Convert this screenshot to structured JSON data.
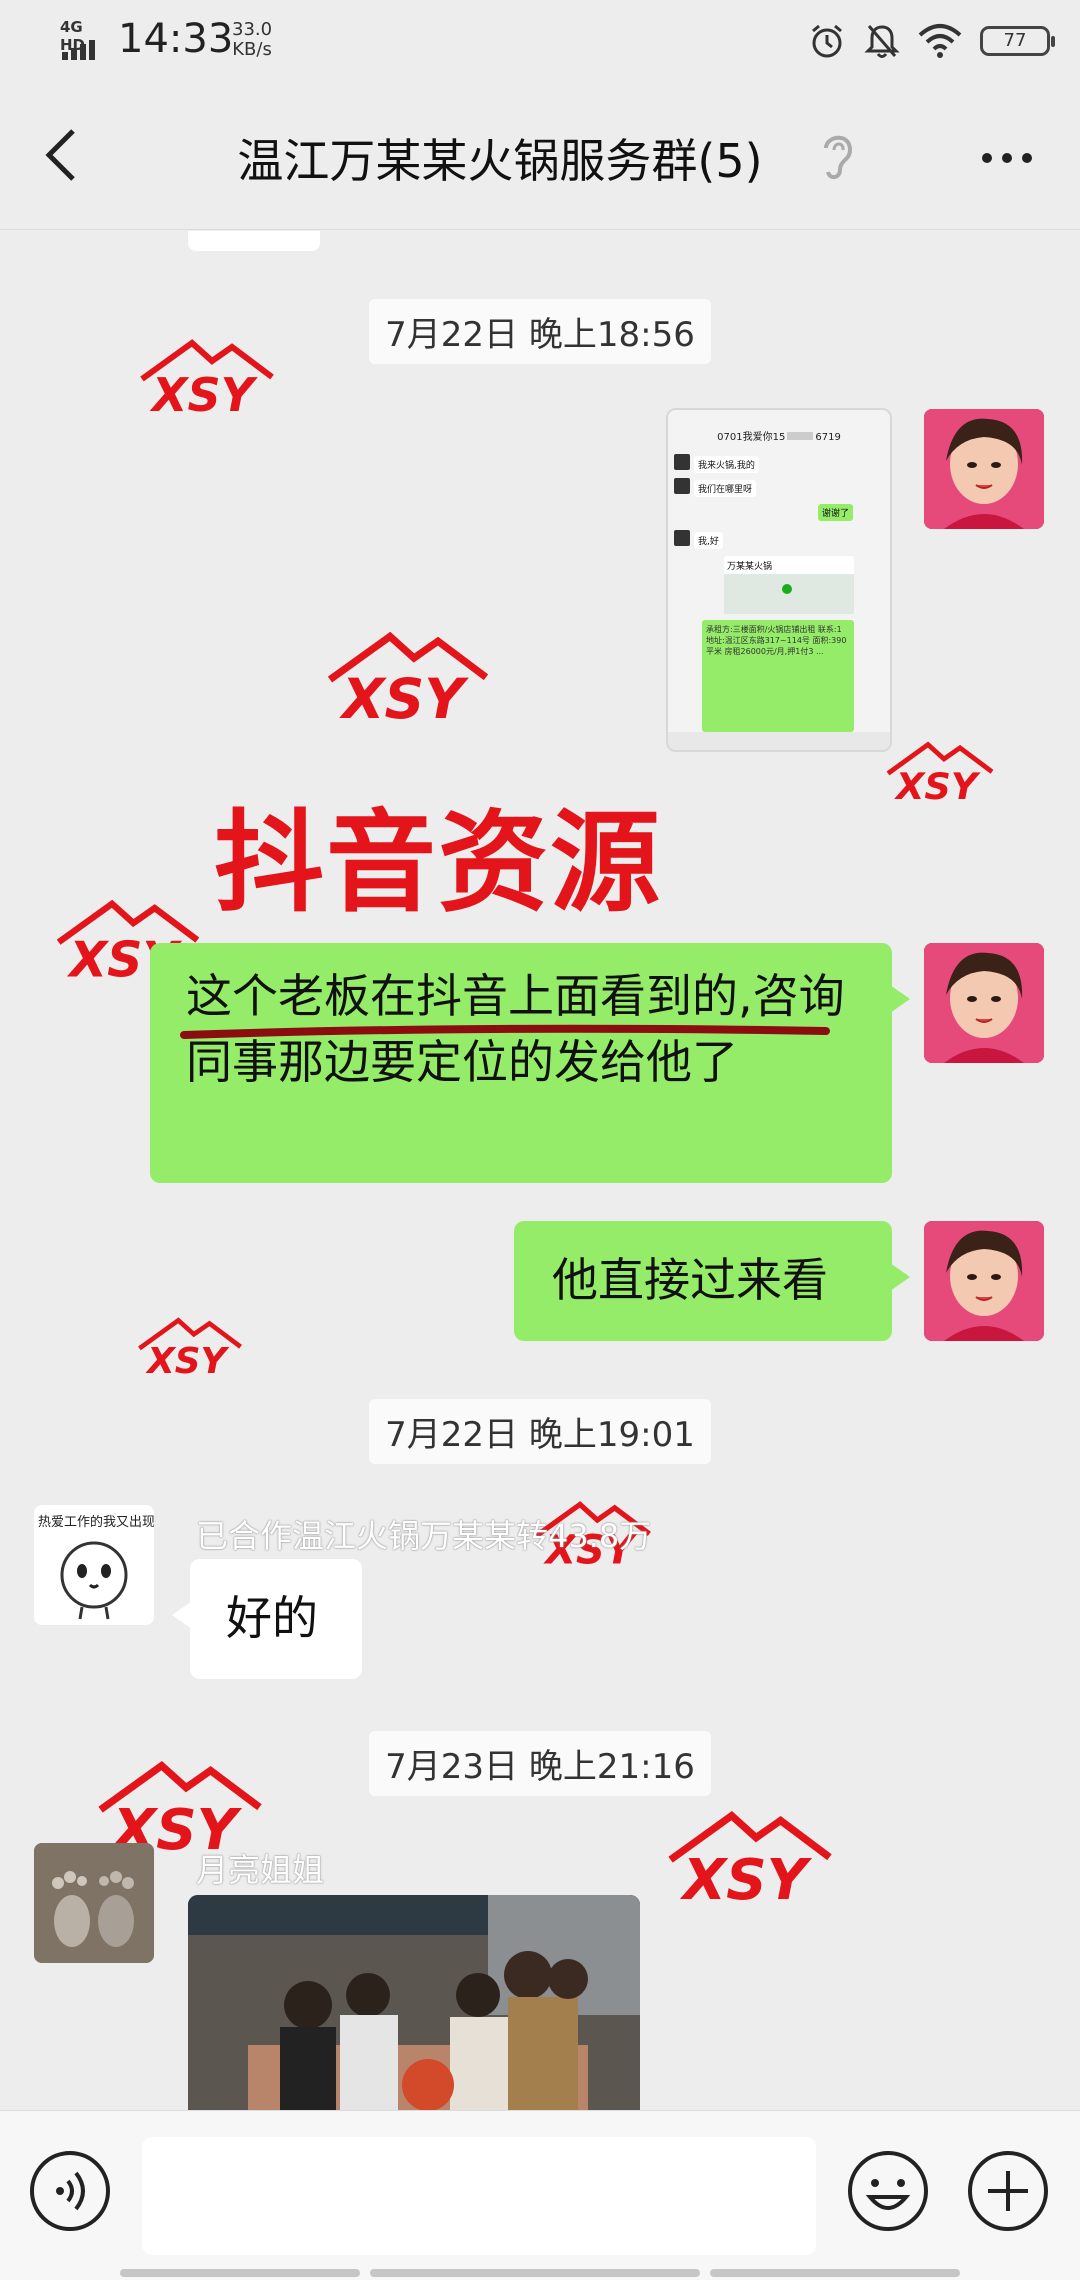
{
  "status_bar": {
    "network": "4G HD",
    "time": "14:33",
    "speed_value": "33.0",
    "speed_unit": "KB/s",
    "battery": "77",
    "icons": [
      "alarm-icon",
      "mute-bell-icon",
      "wifi-icon",
      "battery-icon"
    ]
  },
  "header": {
    "title": "温江万某某火锅服务群(5)",
    "icons": [
      "back-arrow-icon",
      "ear-icon",
      "more-icon"
    ]
  },
  "messages": {
    "ts1": "7月22日 晚上18:56",
    "screenshot": {
      "title": "0701我爱你15",
      "number_tail": "6719",
      "rows": [
        "我来火锅,我的",
        "我们在哪里呀",
        "谢谢了",
        "我,好",
        "万某某火锅"
      ],
      "green_text": "承租方:三楼面积/火锅店铺出租 联系:1 地址:温江区东路317~114号 面积:390平米 房租26000元/月,押1付3 ..."
    },
    "overlay_label": "抖音资源",
    "bubble1": "这个老板在抖音上面看到的,咨询同事那边要定位的发给他了",
    "bubble2": "他直接过来看",
    "ts2": "7月22日 晚上19:01",
    "sender1_name": "已合作温江火锅万某某转43.8万",
    "sender1_avatar_text": "热爱工作的我又出现",
    "reply1": "好的",
    "ts3": "7月23日 晚上21:16",
    "sender2_name": "月亮姐姐",
    "watermark_text": "XSY"
  },
  "input_bar": {
    "placeholder": "",
    "icons": [
      "voice-icon",
      "emoji-icon",
      "plus-icon"
    ]
  },
  "colors": {
    "background": "#ededed",
    "bubble_green": "#95ec69",
    "watermark_red": "#e3141a"
  }
}
